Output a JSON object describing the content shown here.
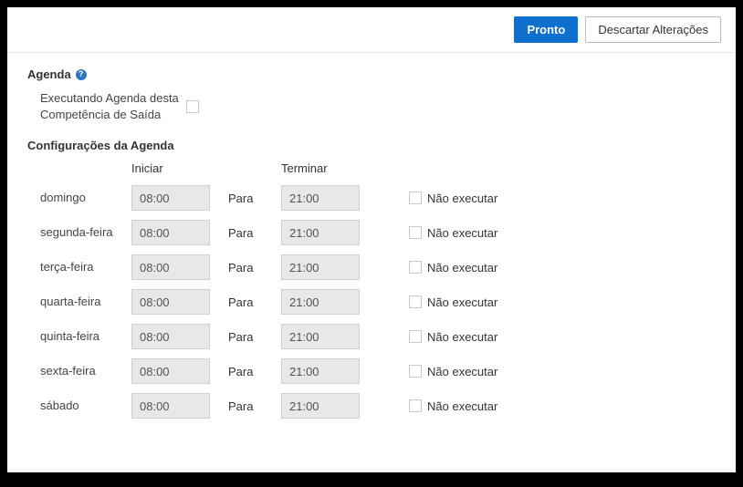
{
  "buttons": {
    "done": "Pronto",
    "discard": "Descartar Alterações"
  },
  "section": {
    "agenda_title": "Agenda",
    "exec_label": "Executando Agenda desta Competência de Saída",
    "exec_checked": false,
    "config_title": "Configurações da Agenda"
  },
  "headers": {
    "start": "Iniciar",
    "end": "Terminar",
    "para": "Para",
    "no_run": "Não executar"
  },
  "days": [
    {
      "name": "domingo",
      "start": "08:00",
      "end": "21:00",
      "no_run": false
    },
    {
      "name": "segunda-feira",
      "start": "08:00",
      "end": "21:00",
      "no_run": false
    },
    {
      "name": "terça-feira",
      "start": "08:00",
      "end": "21:00",
      "no_run": false
    },
    {
      "name": "quarta-feira",
      "start": "08:00",
      "end": "21:00",
      "no_run": false
    },
    {
      "name": "quinta-feira",
      "start": "08:00",
      "end": "21:00",
      "no_run": false
    },
    {
      "name": "sexta-feira",
      "start": "08:00",
      "end": "21:00",
      "no_run": false
    },
    {
      "name": "sábado",
      "start": "08:00",
      "end": "21:00",
      "no_run": false
    }
  ]
}
